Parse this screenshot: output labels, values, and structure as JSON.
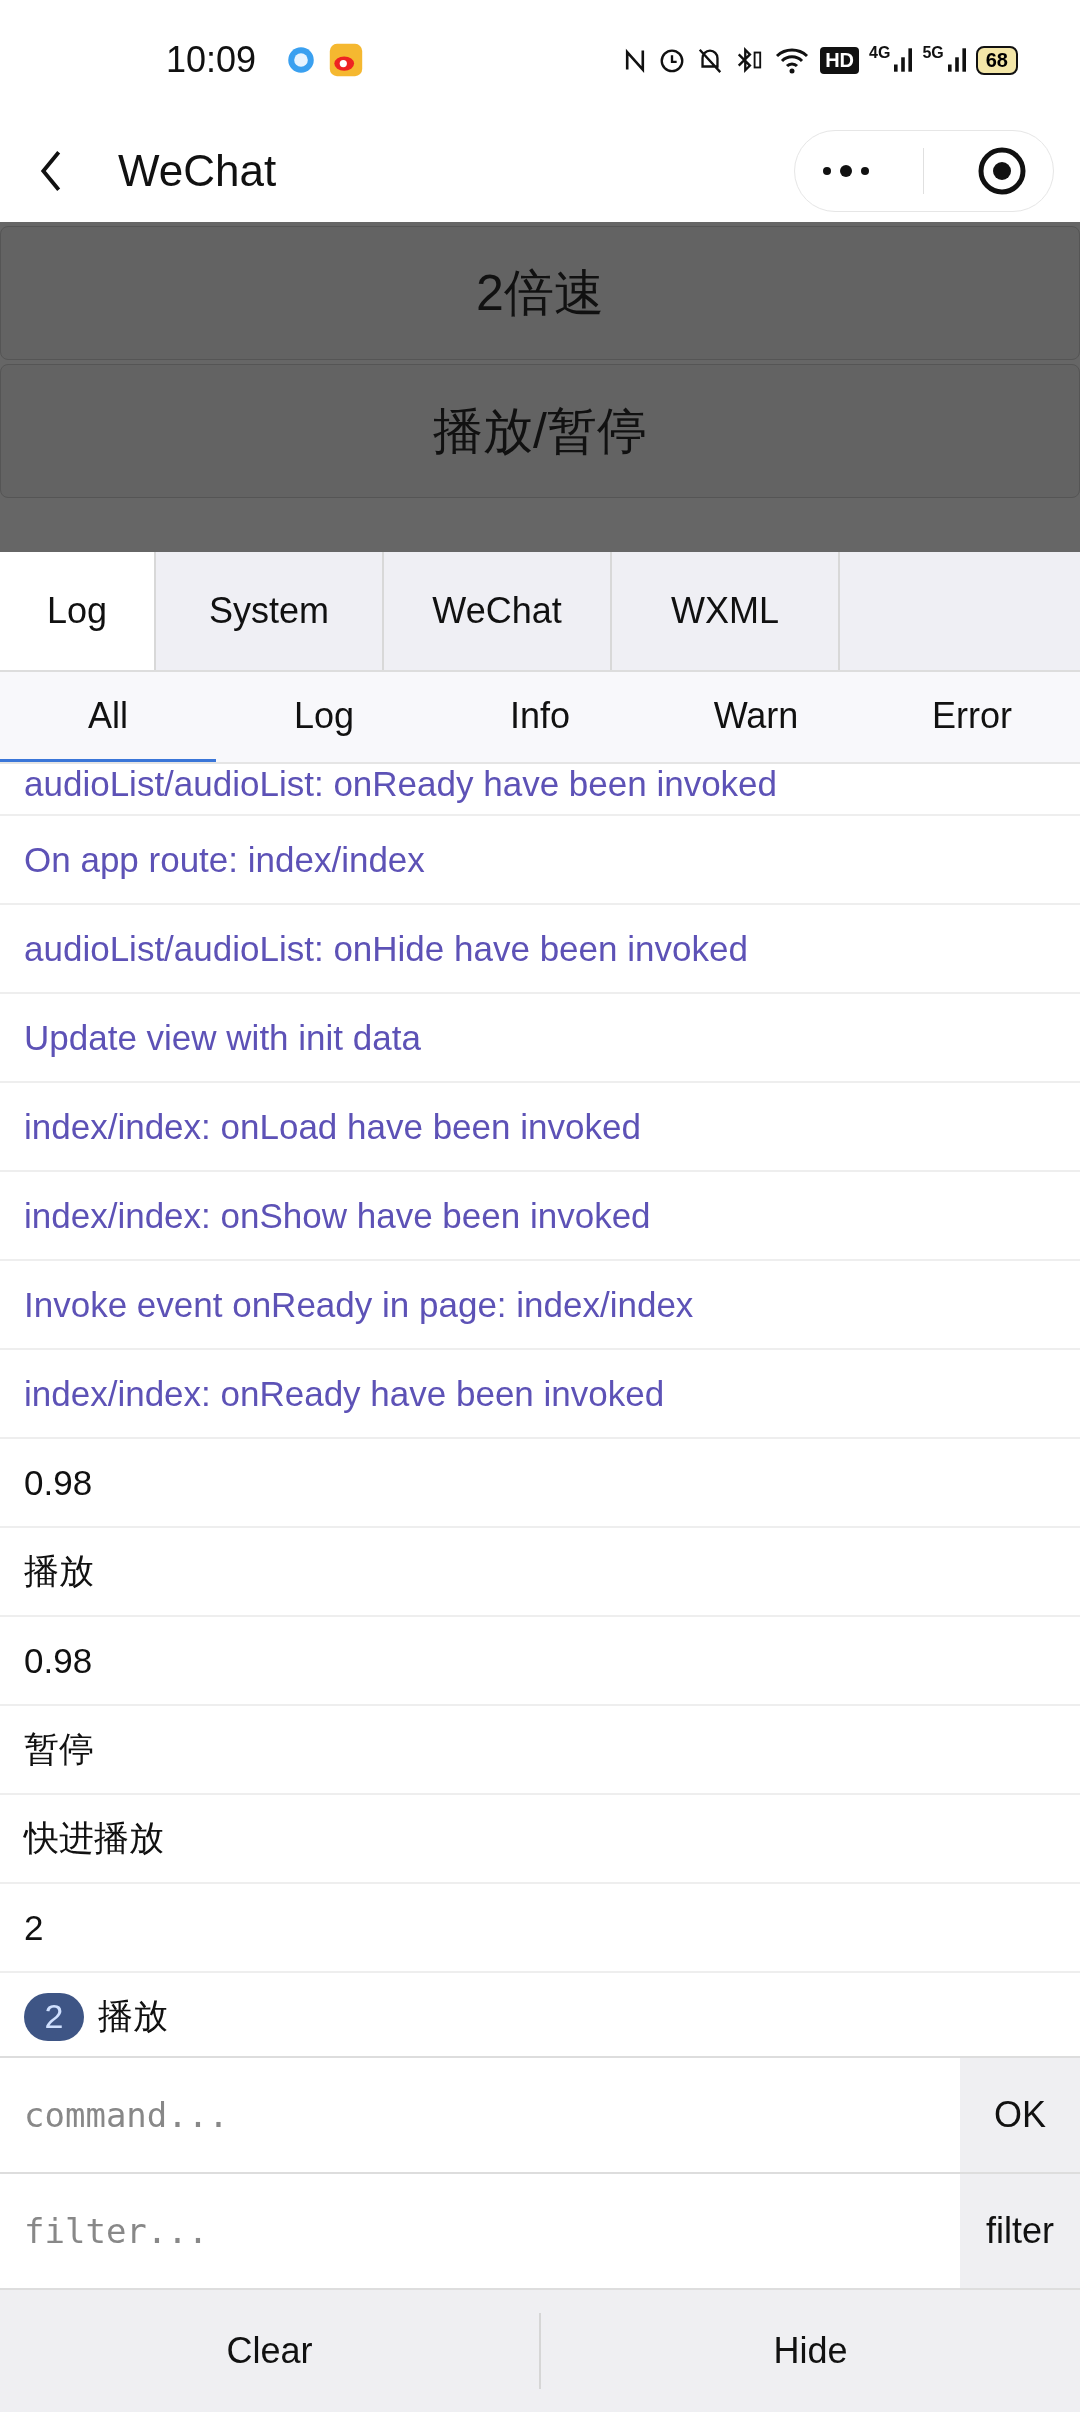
{
  "status_bar": {
    "time": "10:09",
    "hd": "HD",
    "net_4g": "4G",
    "net_5g": "5G",
    "battery": "68"
  },
  "nav": {
    "title": "WeChat"
  },
  "page_buttons": [
    "2倍速",
    "播放/暂停"
  ],
  "tabs": [
    {
      "label": "Log",
      "selected": true
    },
    {
      "label": "System",
      "selected": false
    },
    {
      "label": "WeChat",
      "selected": false
    },
    {
      "label": "WXML",
      "selected": false
    }
  ],
  "filters": [
    {
      "label": "All",
      "selected": true
    },
    {
      "label": "Log",
      "selected": false
    },
    {
      "label": "Info",
      "selected": false
    },
    {
      "label": "Warn",
      "selected": false
    },
    {
      "label": "Error",
      "selected": false
    }
  ],
  "logs": [
    {
      "kind": "system",
      "text": "audioList/audioList: onReady have been invoked"
    },
    {
      "kind": "system",
      "text": "On app route: index/index"
    },
    {
      "kind": "system",
      "text": "audioList/audioList: onHide have been invoked"
    },
    {
      "kind": "system",
      "text": "Update view with init data"
    },
    {
      "kind": "system",
      "text": "index/index: onLoad have been invoked"
    },
    {
      "kind": "system",
      "text": "index/index: onShow have been invoked"
    },
    {
      "kind": "system",
      "text": "Invoke event onReady in page: index/index"
    },
    {
      "kind": "system",
      "text": "index/index: onReady have been invoked"
    },
    {
      "kind": "log",
      "text": "0.98"
    },
    {
      "kind": "log",
      "text": "播放"
    },
    {
      "kind": "log",
      "text": "0.98"
    },
    {
      "kind": "log",
      "text": "暂停"
    },
    {
      "kind": "log",
      "text": "快进播放"
    },
    {
      "kind": "log",
      "text": "2"
    },
    {
      "kind": "log",
      "text": "播放",
      "count": "2"
    }
  ],
  "command": {
    "placeholder": "command...",
    "button": "OK"
  },
  "filter": {
    "placeholder": "filter...",
    "button": "filter"
  },
  "bottom_buttons": [
    "Clear",
    "Hide"
  ]
}
